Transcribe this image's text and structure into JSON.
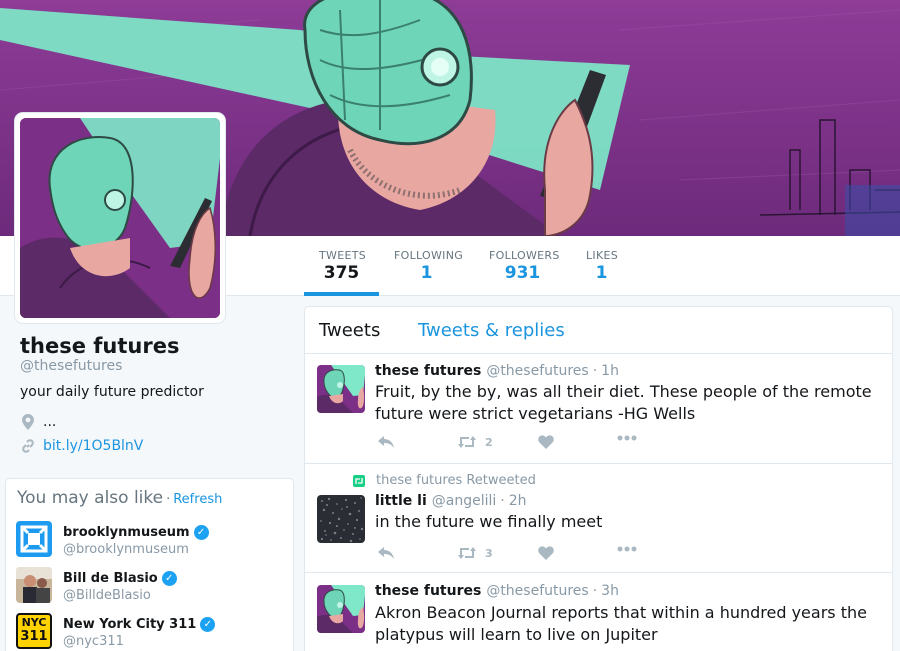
{
  "profile": {
    "name": "these futures",
    "handle": "@thesefutures",
    "bio": "your daily future predictor",
    "location": "...",
    "url": "bit.ly/1O5BlnV"
  },
  "stats": [
    {
      "label": "TWEETS",
      "value": "375"
    },
    {
      "label": "FOLLOWING",
      "value": "1"
    },
    {
      "label": "FOLLOWERS",
      "value": "931"
    },
    {
      "label": "LIKES",
      "value": "1"
    }
  ],
  "who_to_follow": {
    "title": "You may also like",
    "separator": "·",
    "refresh": "Refresh",
    "items": [
      {
        "name": "brooklynmuseum",
        "handle": "@brooklynmuseum"
      },
      {
        "name": "Bill de Blasio",
        "handle": "@BilldeBlasio"
      },
      {
        "name": "New York City 311",
        "handle": "@nyc311",
        "avatar_text_top": "NYC",
        "avatar_text_bottom": "311"
      }
    ]
  },
  "timeline": {
    "tabs": {
      "tweets": "Tweets",
      "replies": "Tweets & replies"
    },
    "tweets": [
      {
        "name": "these futures",
        "handle": "@thesefutures",
        "sep": "·",
        "time": "1h",
        "text": "Fruit, by the by, was all their diet. These people of the remote future were strict vegetarians -HG Wells",
        "retweets": "2"
      },
      {
        "context": "these futures Retweeted",
        "name": "little li",
        "handle": "@angelili",
        "sep": "·",
        "time": "2h",
        "text": "in the future we finally meet",
        "retweets": "3"
      },
      {
        "name": "these futures",
        "handle": "@thesefutures",
        "sep": "·",
        "time": "3h",
        "text": "Akron Beacon Journal reports that within a hundred years the platypus will learn to live on Jupiter"
      }
    ]
  },
  "colors": {
    "accent": "#1b95e0",
    "banner_purple": "#7b2f86",
    "beam_mint": "#6fe3c0",
    "retweet_green": "#19cf86"
  }
}
